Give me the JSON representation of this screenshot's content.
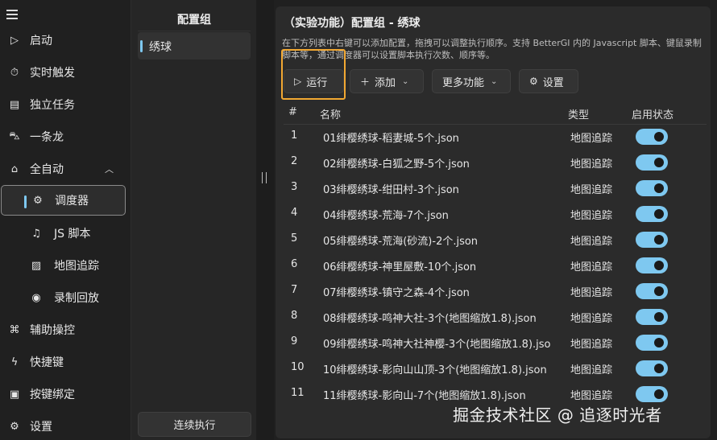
{
  "nav": {
    "items": [
      {
        "label": "启动",
        "icon": "play-icon"
      },
      {
        "label": "实时触发",
        "icon": "timer-icon"
      },
      {
        "label": "独立任务",
        "icon": "list-icon"
      },
      {
        "label": "一条龙",
        "icon": "car-icon"
      },
      {
        "label": "全自动",
        "icon": "robot-icon"
      },
      {
        "label": "调度器",
        "icon": "gear-icon"
      },
      {
        "label": "JS 脚本",
        "icon": "script-icon"
      },
      {
        "label": "地图追踪",
        "icon": "map-icon"
      },
      {
        "label": "录制回放",
        "icon": "record-icon"
      },
      {
        "label": "辅助操控",
        "icon": "gamepad-icon"
      },
      {
        "label": "快捷键",
        "icon": "lightning-icon"
      },
      {
        "label": "按键绑定",
        "icon": "keyboard-icon"
      },
      {
        "label": "设置",
        "icon": "settings-icon"
      }
    ]
  },
  "middle": {
    "title": "配置组",
    "groups": [
      "绣球"
    ],
    "run_continuous": "连续执行"
  },
  "main": {
    "title": "（实验功能）配置组 - 绣球",
    "description": "在下方列表中右键可以添加配置，拖拽可以调整执行顺序。支持 BetterGI 内的 Javascript 脚本、键鼠录制脚本等，通过调度器可以设置脚本执行次数、顺序等。",
    "buttons": {
      "run": "运行",
      "add": "添加",
      "more": "更多功能",
      "settings": "设置"
    },
    "columns": {
      "index": "#",
      "name": "名称",
      "type": "类型",
      "status": "启用状态"
    },
    "rows": [
      {
        "index": "1",
        "name": "01绯樱绣球-稻妻城-5个.json",
        "type": "地图追踪",
        "enabled": true
      },
      {
        "index": "2",
        "name": "02绯樱绣球-白狐之野-5个.json",
        "type": "地图追踪",
        "enabled": true
      },
      {
        "index": "3",
        "name": "03绯樱绣球-绀田村-3个.json",
        "type": "地图追踪",
        "enabled": true
      },
      {
        "index": "4",
        "name": "04绯樱绣球-荒海-7个.json",
        "type": "地图追踪",
        "enabled": true
      },
      {
        "index": "5",
        "name": "05绯樱绣球-荒海(砂流)-2个.json",
        "type": "地图追踪",
        "enabled": true
      },
      {
        "index": "6",
        "name": "06绯樱绣球-神里屋敷-10个.json",
        "type": "地图追踪",
        "enabled": true
      },
      {
        "index": "7",
        "name": "07绯樱绣球-镇守之森-4个.json",
        "type": "地图追踪",
        "enabled": true
      },
      {
        "index": "8",
        "name": "08绯樱绣球-鸣神大社-3个(地图缩放1.8).json",
        "type": "地图追踪",
        "enabled": true
      },
      {
        "index": "9",
        "name": "09绯樱绣球-鸣神大社神樱-3个(地图缩放1.8).jso",
        "type": "地图追踪",
        "enabled": true
      },
      {
        "index": "10",
        "name": "10绯樱绣球-影向山山顶-3个(地图缩放1.8).json",
        "type": "地图追踪",
        "enabled": true
      },
      {
        "index": "11",
        "name": "11绯樱绣球-影向山-7个(地图缩放1.8).json",
        "type": "地图追踪",
        "enabled": true
      }
    ]
  },
  "watermark": "掘金技术社区 @ 追逐时光者",
  "colors": {
    "accent": "#7ec8f0",
    "highlight": "#f2a832",
    "background": "#202020",
    "panel": "#2b2b2b"
  }
}
